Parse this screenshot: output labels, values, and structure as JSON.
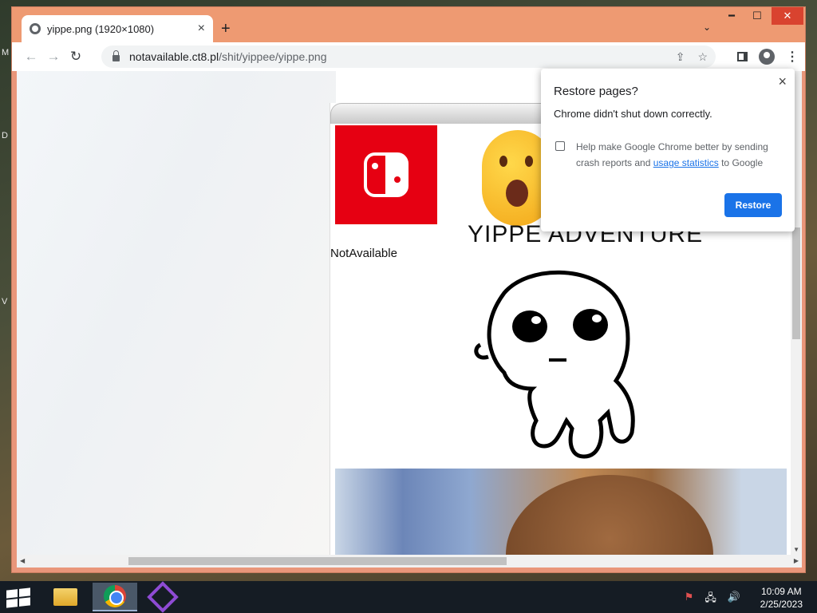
{
  "tab": {
    "title": "yippe.png (1920×1080)",
    "close": "×",
    "new": "+",
    "list": "⌄"
  },
  "window": {
    "minimize": "━",
    "maximize": "☐",
    "close": "✕"
  },
  "nav": {
    "back": "←",
    "forward": "→",
    "reload": "↻"
  },
  "url": {
    "host": "notavailable.ct8.pl",
    "path": "/shit/yippee/yippe.png"
  },
  "omni": {
    "share": "⇪",
    "star": "☆"
  },
  "menu": "⋮",
  "image": {
    "title": "YIPPE ADVENTURE",
    "label": "NotAvailable"
  },
  "popup": {
    "title": "Restore pages?",
    "message": "Chrome didn't shut down correctly.",
    "checkbox_pre": "Help make Google Chrome better by sending crash reports and ",
    "checkbox_link": "usage statistics",
    "checkbox_post": " to Google",
    "close": "×",
    "restore": "Restore"
  },
  "taskbar": {
    "time": "10:09 AM",
    "date": "2/25/2023",
    "tray_network": "🖧",
    "tray_volume": "🔊",
    "tray_flag": "⚑"
  },
  "desktop_letters": [
    "M",
    "D",
    "V"
  ],
  "colors": {
    "titlebar": "#ee9a72",
    "accent": "#1a73e8",
    "switch_red": "#e60012"
  }
}
